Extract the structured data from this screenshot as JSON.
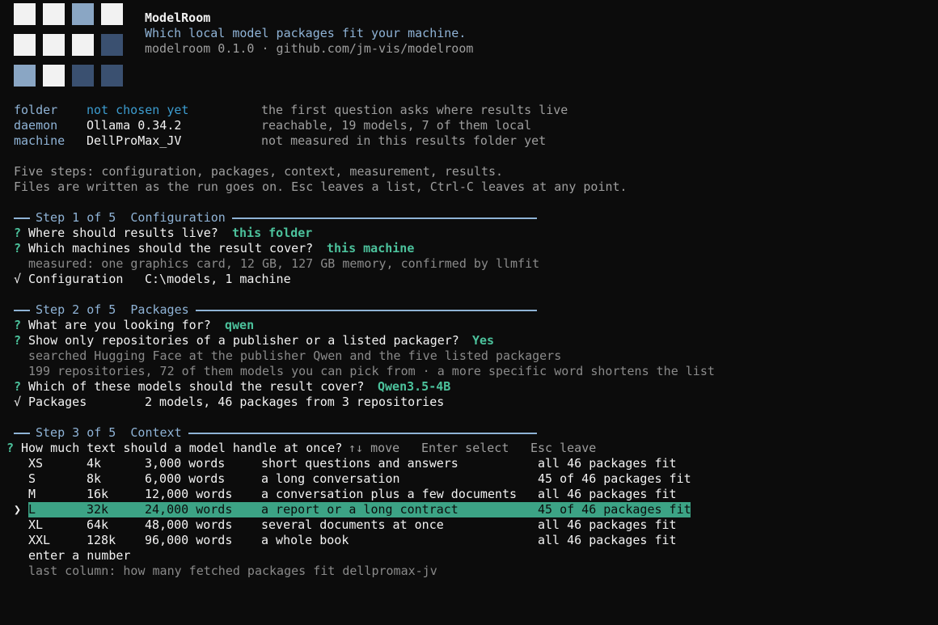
{
  "header": {
    "app_name": "ModelRoom",
    "tagline": "Which local model packages fit your machine.",
    "version_line": "modelroom 0.1.0 · github.com/jm-vis/modelroom"
  },
  "status": [
    {
      "key": "folder",
      "value": "not chosen yet",
      "note": "the first question asks where results live"
    },
    {
      "key": "daemon",
      "value": "Ollama 0.34.2",
      "note": "reachable, 19 models, 7 of them local"
    },
    {
      "key": "machine",
      "value": "DellProMax_JV",
      "note": "not measured in this results folder yet"
    }
  ],
  "intro": {
    "line1": "Five steps: configuration, packages, context, measurement, results.",
    "line2": "Files are written as the run goes on. Esc leaves a list, Ctrl-C leaves at any point."
  },
  "step1": {
    "title": "Step 1 of 5  Configuration",
    "q1_mark": "?",
    "q1": "Where should results live?",
    "a1": "this folder",
    "q2_mark": "?",
    "q2": "Which machines should the result cover?",
    "a2": "this machine",
    "info": "measured: one graphics card, 12 GB, 127 GB memory, confirmed by llmfit",
    "done_mark": "√",
    "done_label": "Configuration",
    "done_value": "C:\\models, 1 machine"
  },
  "step2": {
    "title": "Step 2 of 5  Packages",
    "q1_mark": "?",
    "q1": "What are you looking for?",
    "a1": "qwen",
    "q2_mark": "?",
    "q2": "Show only repositories of a publisher or a listed packager?",
    "a2": "Yes",
    "info1": "searched Hugging Face at the publisher Qwen and the five listed packagers",
    "info2": "199 repositories, 72 of them models you can pick from · a more specific word shortens the list",
    "q3_mark": "?",
    "q3": "Which of these models should the result cover?",
    "a3": "Qwen3.5-4B",
    "done_mark": "√",
    "done_label": "Packages",
    "done_value": "2 models, 46 packages from 3 repositories"
  },
  "step3": {
    "title": "Step 3 of 5  Context",
    "q_mark": "?",
    "question": "How much text should a model handle at once?",
    "hint_move": "↑↓ move",
    "hint_select": "Enter select",
    "hint_leave": "Esc leave",
    "cursor": "❯",
    "options": [
      {
        "size": "XS",
        "tokens": "4k",
        "words": "3,000 words",
        "desc": "short questions and answers",
        "fit": "all 46 packages fit"
      },
      {
        "size": "S",
        "tokens": "8k",
        "words": "6,000 words",
        "desc": "a long conversation",
        "fit": "45 of 46 packages fit"
      },
      {
        "size": "M",
        "tokens": "16k",
        "words": "12,000 words",
        "desc": "a conversation plus a few documents",
        "fit": "all 46 packages fit"
      },
      {
        "size": "L",
        "tokens": "32k",
        "words": "24,000 words",
        "desc": "a report or a long contract",
        "fit": "45 of 46 packages fit"
      },
      {
        "size": "XL",
        "tokens": "64k",
        "words": "48,000 words",
        "desc": "several documents at once",
        "fit": "all 46 packages fit"
      },
      {
        "size": "XXL",
        "tokens": "128k",
        "words": "96,000 words",
        "desc": "a whole book",
        "fit": "all 46 packages fit"
      }
    ],
    "selected_index": 3,
    "enter_number": "enter a number",
    "footnote": "last column: how many fetched packages fit dellpromax-jv"
  },
  "colors": {
    "background": "#0c0c0c",
    "accent": "#8fb3d6",
    "answer": "#4cc29c",
    "selection": "#3ca385",
    "link": "#3c9ccf"
  }
}
